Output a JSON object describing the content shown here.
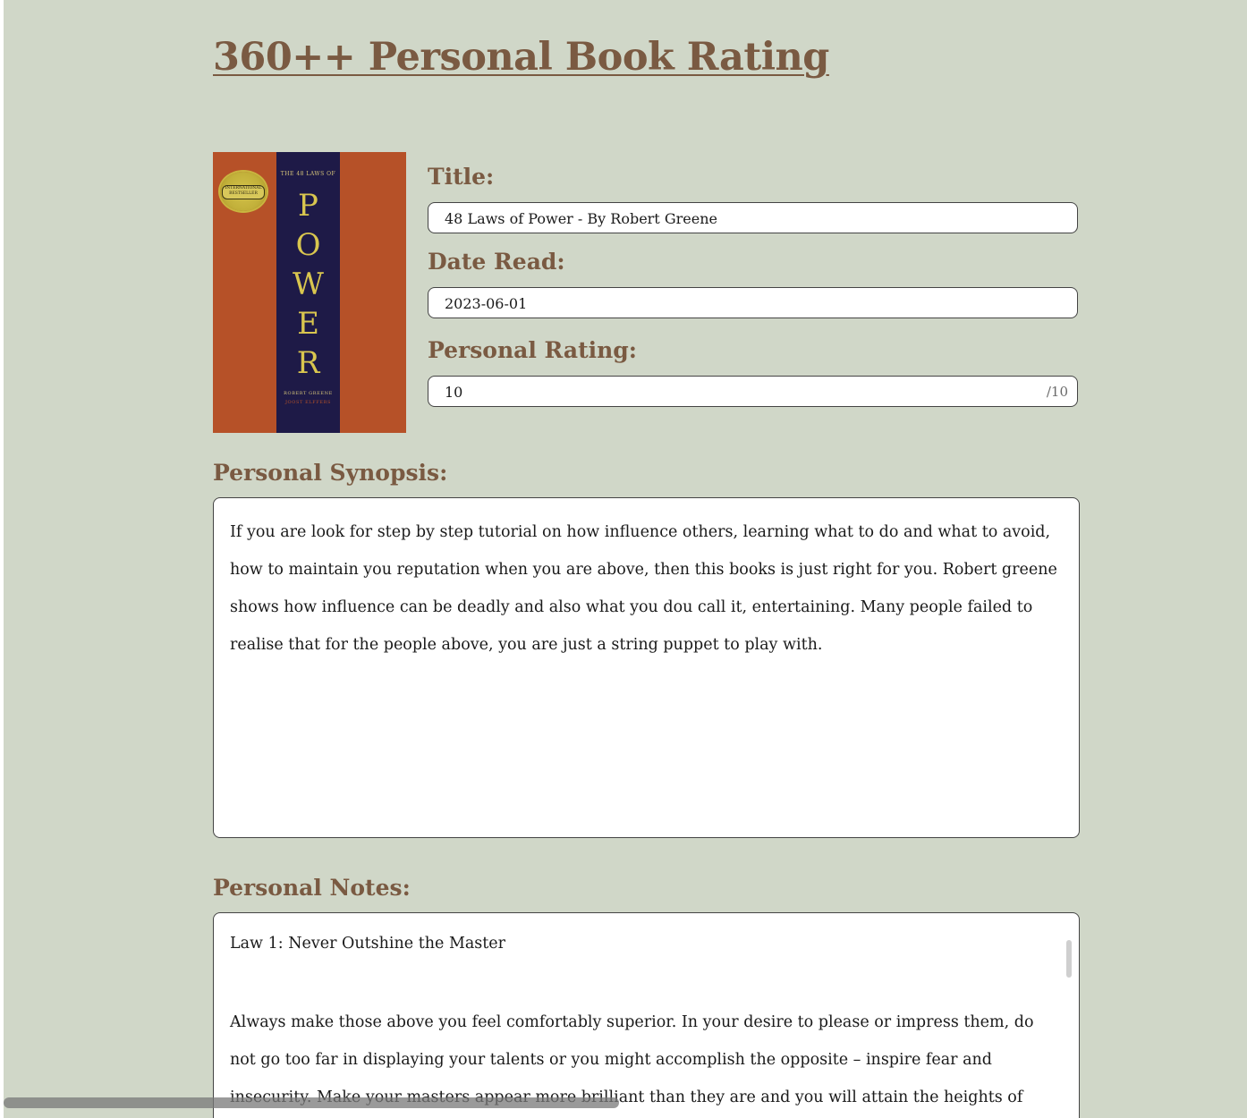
{
  "page": {
    "title": "360++ Personal Book Rating"
  },
  "book": {
    "cover": {
      "top_text": "THE 48 LAWS OF",
      "letters": [
        "P",
        "O",
        "W",
        "E",
        "R"
      ],
      "seal_text": "INTERNATIONAL BESTSELLER",
      "author_line1": "ROBERT GREENE",
      "author_line2": "JOOST ELFFERS"
    }
  },
  "fields": {
    "title_label": "Title:",
    "title_value": "48 Laws of Power - By Robert Greene",
    "date_label": "Date Read:",
    "date_value": "2023-06-01",
    "rating_label": "Personal Rating:",
    "rating_value": "10",
    "rating_suffix": "/10"
  },
  "synopsis": {
    "label": "Personal Synopsis:",
    "text": "If you are look for step by step tutorial on  how influence others, learning what to do and what to avoid, how to maintain you reputation when you are above, then this books is just right for you. Robert greene shows how influence can be deadly and also what you dou call it, entertaining. Many people failed to realise that for the people above, you are just a string puppet to play with."
  },
  "notes": {
    "label": "Personal Notes:",
    "law_title": "Law 1: Never Outshine the Master",
    "law_text": "Always make those above you feel comfortably superior. In your desire to please or impress them, do not go too far in displaying your talents or you might accomplish the opposite – inspire fear and insecurity. Make your masters appear more brilliant than they are and you will attain the heights of"
  },
  "colors": {
    "background": "#d0d7c8",
    "heading": "#7a5a42",
    "cover_orange": "#b65128",
    "cover_spine": "#1e1a47",
    "cover_text": "#d9c64f"
  }
}
